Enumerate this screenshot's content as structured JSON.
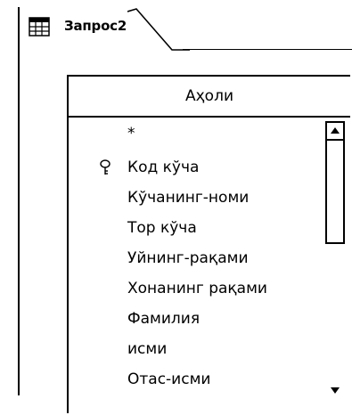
{
  "query_tab": {
    "label": "Запрос2",
    "icon": "query-grid-icon"
  },
  "table": {
    "title": "Аҳоли",
    "fields": [
      {
        "label": "*",
        "primary_key": false
      },
      {
        "label": "Код кўча",
        "primary_key": true
      },
      {
        "label": "Кўчанинг-номи",
        "primary_key": false
      },
      {
        "label": "Тор кўча",
        "primary_key": false
      },
      {
        "label": "Уйнинг-рақами",
        "primary_key": false
      },
      {
        "label": "Хонанинг рақами",
        "primary_key": false
      },
      {
        "label": "Фамилия",
        "primary_key": false
      },
      {
        "label": "исми",
        "primary_key": false
      },
      {
        "label": "Отас-исми",
        "primary_key": false
      }
    ]
  }
}
